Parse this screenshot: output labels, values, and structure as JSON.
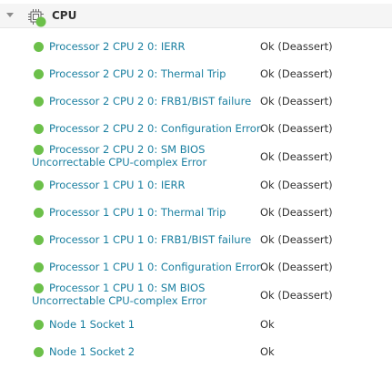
{
  "group": {
    "title": "CPU",
    "icon": "cpu-chip-icon",
    "status_icon": "green-status-dot-icon",
    "collapse_icon": "caret-down-icon"
  },
  "colors": {
    "status_ok": "#6cc04a",
    "link": "#1a7fa0",
    "header_bg": "#f5f5f5"
  },
  "sensors": [
    {
      "label": "Processor 2 CPU 2 0: IERR",
      "status": "Ok (Deassert)"
    },
    {
      "label": "Processor 2 CPU 2 0: Thermal Trip",
      "status": "Ok (Deassert)"
    },
    {
      "label": "Processor 2 CPU 2 0: FRB1/BIST failure",
      "status": "Ok (Deassert)"
    },
    {
      "label": "Processor 2 CPU 2 0: Configuration Error",
      "status": "Ok (Deassert)"
    },
    {
      "label": "Processor 2 CPU 2 0: SM BIOS Uncorrectable CPU-complex Error",
      "status": "Ok (Deassert)"
    },
    {
      "label": "Processor 1 CPU 1 0: IERR",
      "status": "Ok (Deassert)"
    },
    {
      "label": "Processor 1 CPU 1 0: Thermal Trip",
      "status": "Ok (Deassert)"
    },
    {
      "label": "Processor 1 CPU 1 0: FRB1/BIST failure",
      "status": "Ok (Deassert)"
    },
    {
      "label": "Processor 1 CPU 1 0: Configuration Error",
      "status": "Ok (Deassert)"
    },
    {
      "label": "Processor 1 CPU 1 0: SM BIOS Uncorrectable CPU-complex Error",
      "status": "Ok (Deassert)"
    },
    {
      "label": "Node 1 Socket 1",
      "status": "Ok"
    },
    {
      "label": "Node 1 Socket 2",
      "status": "Ok"
    }
  ]
}
